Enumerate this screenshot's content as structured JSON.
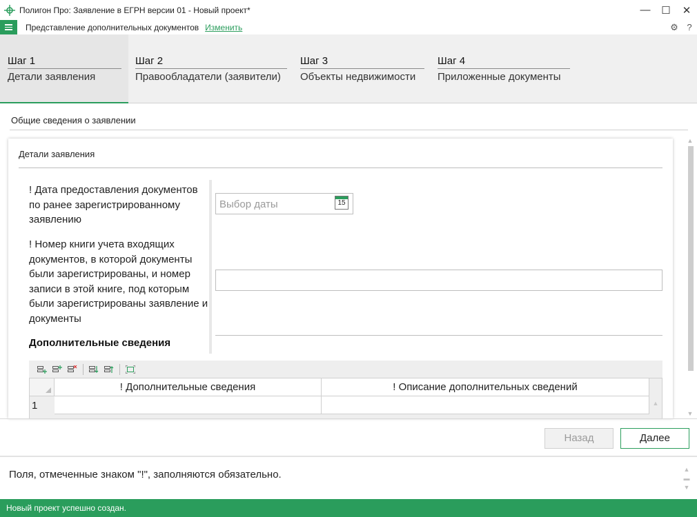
{
  "window": {
    "title": "Полигон Про: Заявление в ЕГРН версии 01 - Новый проект*",
    "minimize": "—",
    "maximize": "☐",
    "close": "✕"
  },
  "menubar": {
    "title": "Представление дополнительных документов",
    "change_link": "Изменить",
    "settings_icon": "⚙",
    "help": "?"
  },
  "steps": [
    {
      "num": "Шаг 1",
      "name": "Детали заявления"
    },
    {
      "num": "Шаг 2",
      "name": "Правообладатели (заявители)"
    },
    {
      "num": "Шаг 3",
      "name": "Объекты недвижимости"
    },
    {
      "num": "Шаг 4",
      "name": "Приложенные документы"
    }
  ],
  "section": {
    "title": "Общие сведения о заявлении"
  },
  "card": {
    "title": "Детали заявления",
    "date_label": "! Дата предоставления документов по ранее зарегистрированному заявлению",
    "date_placeholder": "Выбор даты",
    "calendar_day": "15",
    "book_label": "! Номер книги учета входящих документов, в которой документы были зарегистрированы, и номер записи в этой книге, под которым были зарегистрированы заявление и документы",
    "book_value": "",
    "additional_title": "Дополнительные сведения"
  },
  "table": {
    "columns": [
      "! Дополнительные сведения",
      "! Описание дополнительных сведений"
    ],
    "rows": [
      {
        "num": "1",
        "info": "",
        "desc": ""
      }
    ]
  },
  "buttons": {
    "back": "Назад",
    "next": "Далее"
  },
  "info": {
    "text": "Поля, отмеченные знаком \"!\", заполняются обязательно."
  },
  "status": {
    "text": "Новый проект успешно создан."
  },
  "colors": {
    "accent": "#2a9d5c"
  }
}
